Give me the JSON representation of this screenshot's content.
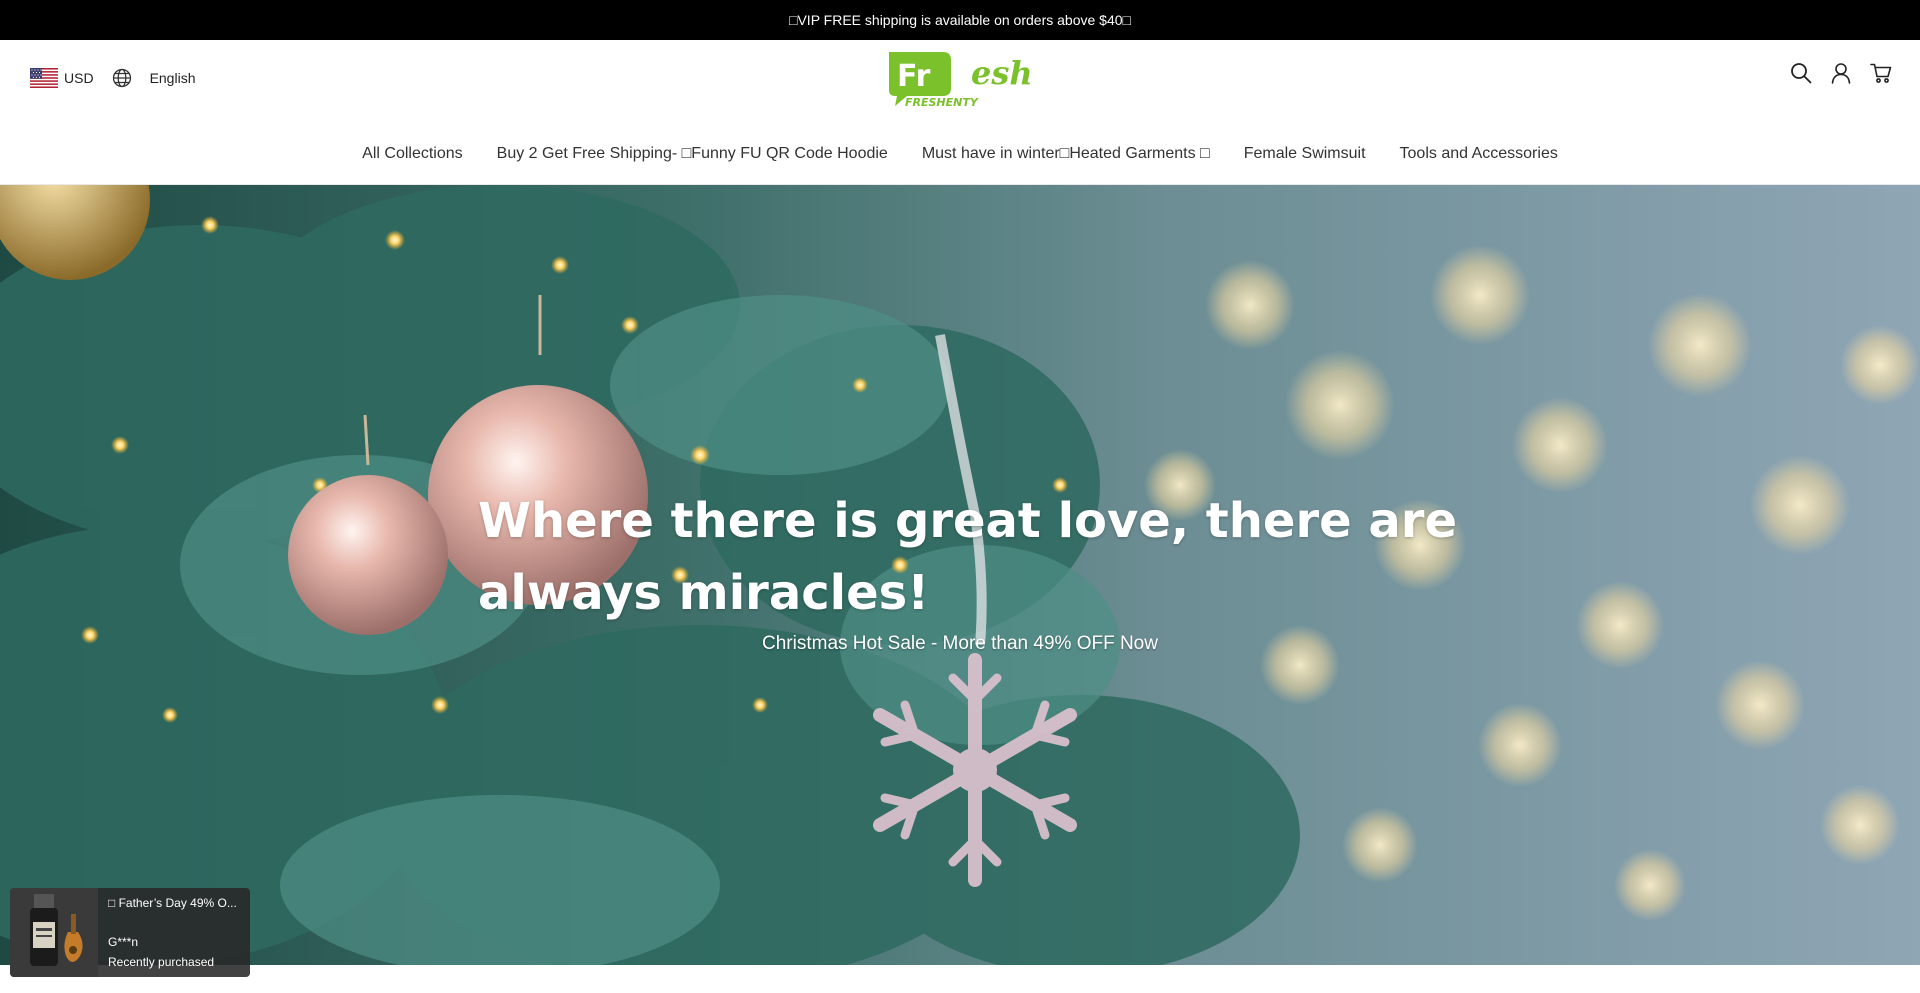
{
  "announcement": {
    "text": "□VIP FREE shipping is available on orders above $40□"
  },
  "locale": {
    "currency_flag_icon": "us-flag-icon",
    "currency_label": "USD",
    "language_icon": "globe-icon",
    "language_label": "English"
  },
  "logo": {
    "mark_text": "Fr",
    "script_text": "esh",
    "sub_text": "FRESHENTY",
    "color": "#7ac12b"
  },
  "header_icons": [
    "search-icon",
    "account-icon",
    "cart-icon"
  ],
  "nav": {
    "items": [
      {
        "label": "All Collections"
      },
      {
        "label": "Buy 2 Get Free Shipping- □Funny FU QR Code Hoodie"
      },
      {
        "label": "Must have in winter□Heated Garments □"
      },
      {
        "label": "Female Swimsuit"
      },
      {
        "label": "Tools and Accessories"
      }
    ]
  },
  "hero": {
    "title": "Where there is great love, there are always miracles!",
    "subtitle": "Christmas Hot Sale - More than 49% OFF Now"
  },
  "purchase_popup": {
    "title": "□ Father’s Day 49% O...",
    "customer": "G***n",
    "status": "Recently purchased"
  },
  "colors": {
    "announcement_bg": "#000000",
    "brand_green": "#7ac12b",
    "nav_text": "#333333"
  }
}
